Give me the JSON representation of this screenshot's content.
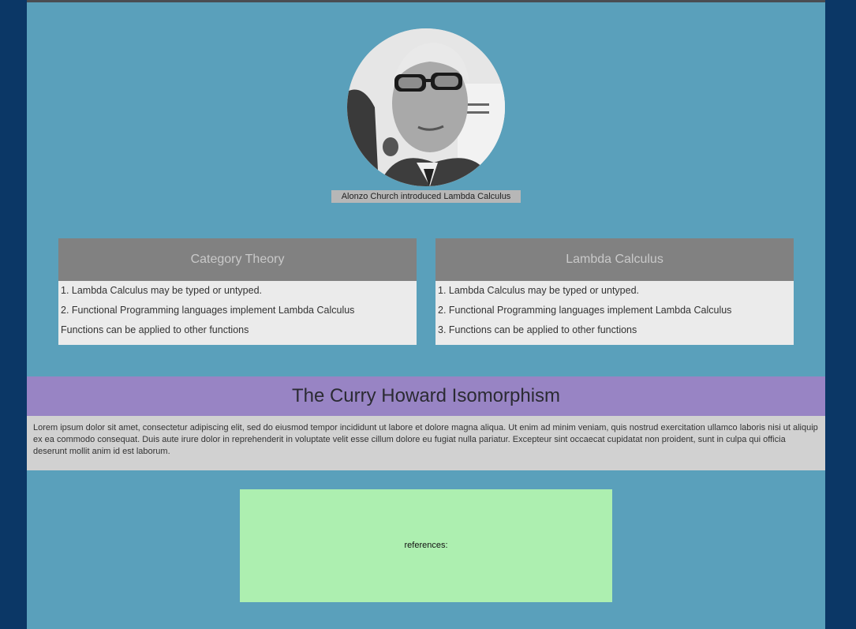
{
  "portrait": {
    "icon": "person-portrait-photo",
    "caption": "Alonzo Church introduced Lambda Calculus"
  },
  "cards": [
    {
      "title": "Category Theory",
      "items": [
        "1. Lambda Calculus may be typed or untyped.",
        "2. Functional Programming languages implement Lambda Calculus",
        "Functions can be applied to other functions"
      ]
    },
    {
      "title": "Lambda Calculus",
      "items": [
        "1. Lambda Calculus may be typed or untyped.",
        "2. Functional Programming languages implement Lambda Calculus",
        "3. Functions can be applied to other functions"
      ]
    }
  ],
  "banner": {
    "title": "The Curry Howard Isomorphism"
  },
  "lorem": {
    "text": "Lorem ipsum dolor sit amet, consectetur adipiscing elit, sed do eiusmod tempor incididunt ut labore et dolore magna aliqua. Ut enim ad minim veniam, quis nostrud exercitation ullamco laboris nisi ut aliquip ex ea commodo consequat. Duis aute irure dolor in reprehenderit in voluptate velit esse cillum dolore eu fugiat nulla pariatur. Excepteur sint occaecat cupidatat non proident, sunt in culpa qui officia deserunt mollit anim id est laborum."
  },
  "references": {
    "label": "references:"
  },
  "colors": {
    "outer_background": "#0b3766",
    "page_background": "#5aa0bb",
    "card_header": "#818181",
    "card_body": "#ebebeb",
    "banner": "#9884c4",
    "lorem_background": "#d1d1d1",
    "references_background": "#adefb0"
  }
}
